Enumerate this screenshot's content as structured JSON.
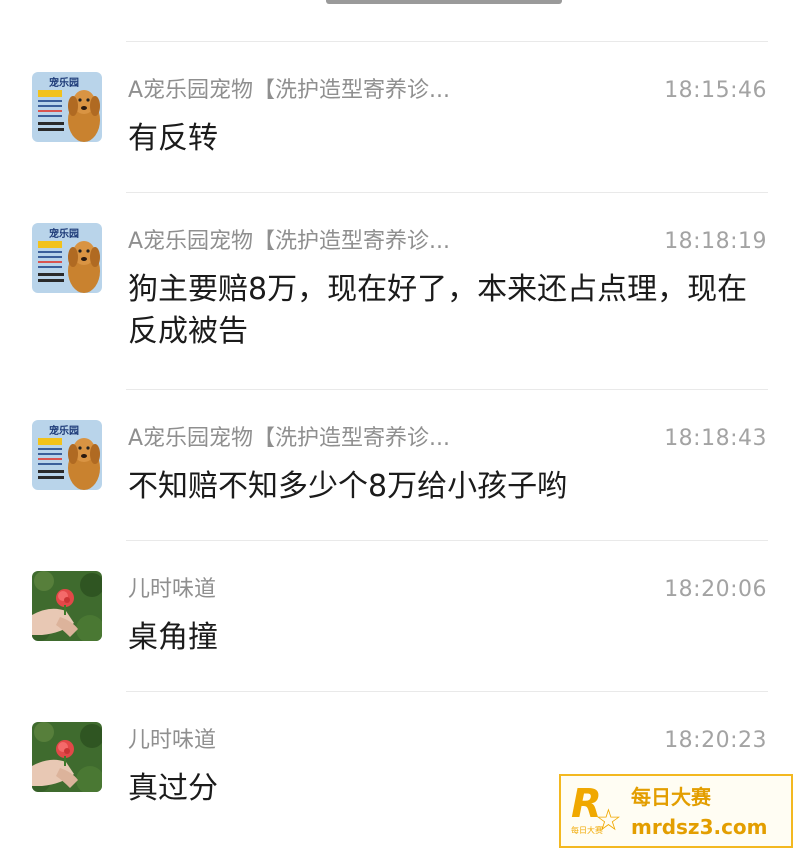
{
  "messages": [
    {
      "sender": "A宠乐园宠物【洗护造型寄养诊...",
      "time": "18:15:46",
      "text": "有反转",
      "avatar": "golden-retriever-avatar"
    },
    {
      "sender": "A宠乐园宠物【洗护造型寄养诊...",
      "time": "18:18:19",
      "text": "狗主要赔8万，现在好了，本来还占点理，现在反成被告",
      "avatar": "golden-retriever-avatar"
    },
    {
      "sender": "A宠乐园宠物【洗护造型寄养诊...",
      "time": "18:18:43",
      "text": "不知赔不知多少个8万给小孩子哟",
      "avatar": "golden-retriever-avatar"
    },
    {
      "sender": "儿时味道",
      "time": "18:20:06",
      "text": "桌角撞",
      "avatar": "rose-in-hand-avatar"
    },
    {
      "sender": "儿时味道",
      "time": "18:20:23",
      "text": "真过分",
      "avatar": "rose-in-hand-avatar"
    }
  ],
  "avatar_label": "宠乐园",
  "watermark": {
    "title": "每日大赛",
    "url": "mrdsz3.com",
    "logo_letter": "R",
    "logo_small": "每日大赛"
  },
  "colors": {
    "sender": "#8f8f8f",
    "time": "#a3a3a3",
    "text": "#1b1b1b",
    "divider": "#e9e9e9",
    "watermark": "#f0a800"
  }
}
